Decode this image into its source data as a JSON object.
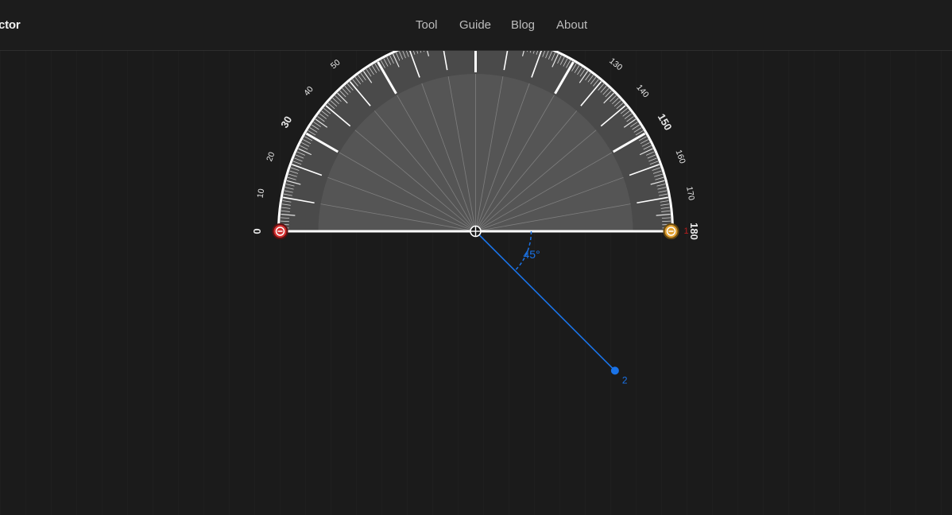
{
  "header": {
    "brand": "ctor",
    "nav": [
      {
        "id": "tool",
        "label": "Tool"
      },
      {
        "id": "guide",
        "label": "Guide"
      },
      {
        "id": "blog",
        "label": "Blog"
      },
      {
        "id": "about",
        "label": "About"
      }
    ]
  },
  "protractor": {
    "visible_scale_labels": [
      "0",
      "10",
      "20",
      "30",
      "40",
      "50",
      "130",
      "140",
      "150",
      "160",
      "170",
      "180"
    ],
    "angle_readout": "45°",
    "point_labels": {
      "point_1": "1",
      "point_2": "2"
    },
    "measured_angle_deg": 45
  },
  "colors": {
    "background": "#1b1b1b",
    "accent_blue": "#1a73e8",
    "left_handle": "#d32f2f",
    "right_handle": "#e0a030",
    "point_1_label": "#b71c1c"
  }
}
